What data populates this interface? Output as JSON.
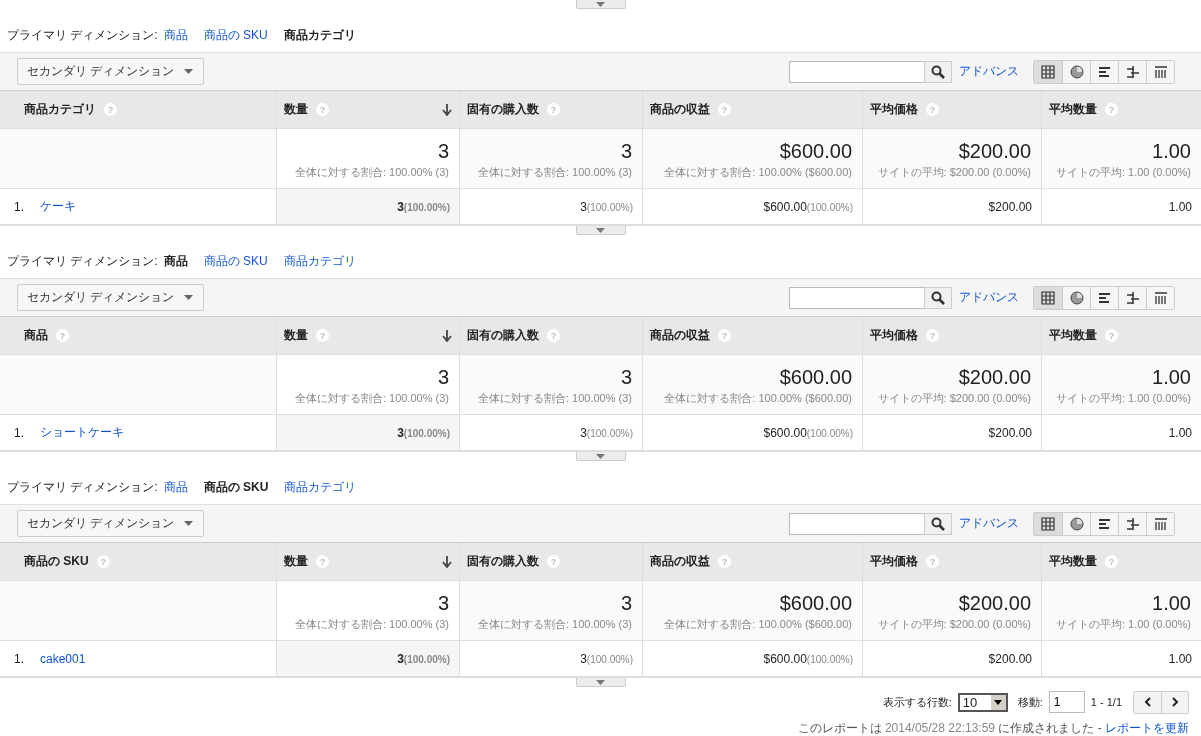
{
  "sections": [
    {
      "primary_dimension": {
        "label": "プライマリ ディメンション:",
        "options": [
          {
            "label": "商品",
            "selected": false
          },
          {
            "label": "商品の SKU",
            "selected": false
          },
          {
            "label": "商品カテゴリ",
            "selected": true
          }
        ]
      },
      "secondary_dimension": "セカンダリ ディメンション",
      "advanced_link": "アドバンス",
      "view_modes": [
        {
          "kind": "table",
          "selected": true
        },
        {
          "kind": "pie",
          "selected": false
        },
        {
          "kind": "bars",
          "selected": false
        },
        {
          "kind": "compare",
          "selected": false
        },
        {
          "kind": "pivot",
          "selected": false
        }
      ],
      "columns": [
        {
          "label": "商品カテゴリ",
          "help": "?",
          "sorted": false
        },
        {
          "label": "数量",
          "help": "?",
          "sorted": true
        },
        {
          "label": "固有の購入数",
          "help": "?",
          "sorted": false
        },
        {
          "label": "商品の収益",
          "help": "?",
          "sorted": false
        },
        {
          "label": "平均価格",
          "help": "?",
          "sorted": false
        },
        {
          "label": "平均数量",
          "help": "?",
          "sorted": false
        }
      ],
      "totals": [
        {
          "value": "3",
          "note": "全体に対する割合: 100.00% (3)"
        },
        {
          "value": "3",
          "note": "全体に対する割合: 100.00% (3)"
        },
        {
          "value": "$600.00",
          "note": "全体に対する割合: 100.00% ($600.00)"
        },
        {
          "value": "$200.00",
          "note": "サイトの平均: $200.00 (0.00%)"
        },
        {
          "value": "1.00",
          "note": "サイトの平均: 1.00 (0.00%)"
        }
      ],
      "rows": [
        {
          "index": "1.",
          "label": "ケーキ",
          "cells": [
            {
              "value": "3",
              "share": "(100.00%)"
            },
            {
              "value": "3",
              "share": "(100.00%)"
            },
            {
              "value": "$600.00",
              "share": "(100.00%)"
            },
            {
              "value": "$200.00"
            },
            {
              "value": "1.00"
            }
          ]
        }
      ]
    },
    {
      "primary_dimension": {
        "label": "プライマリ ディメンション:",
        "options": [
          {
            "label": "商品",
            "selected": true
          },
          {
            "label": "商品の SKU",
            "selected": false
          },
          {
            "label": "商品カテゴリ",
            "selected": false
          }
        ]
      },
      "secondary_dimension": "セカンダリ ディメンション",
      "advanced_link": "アドバンス",
      "view_modes": [
        {
          "kind": "table",
          "selected": true
        },
        {
          "kind": "pie",
          "selected": false
        },
        {
          "kind": "bars",
          "selected": false
        },
        {
          "kind": "compare",
          "selected": false
        },
        {
          "kind": "pivot",
          "selected": false
        }
      ],
      "columns": [
        {
          "label": "商品",
          "help": "?",
          "sorted": false
        },
        {
          "label": "数量",
          "help": "?",
          "sorted": true
        },
        {
          "label": "固有の購入数",
          "help": "?",
          "sorted": false
        },
        {
          "label": "商品の収益",
          "help": "?",
          "sorted": false
        },
        {
          "label": "平均価格",
          "help": "?",
          "sorted": false
        },
        {
          "label": "平均数量",
          "help": "?",
          "sorted": false
        }
      ],
      "totals": [
        {
          "value": "3",
          "note": "全体に対する割合: 100.00% (3)"
        },
        {
          "value": "3",
          "note": "全体に対する割合: 100.00% (3)"
        },
        {
          "value": "$600.00",
          "note": "全体に対する割合: 100.00% ($600.00)"
        },
        {
          "value": "$200.00",
          "note": "サイトの平均: $200.00 (0.00%)"
        },
        {
          "value": "1.00",
          "note": "サイトの平均: 1.00 (0.00%)"
        }
      ],
      "rows": [
        {
          "index": "1.",
          "label": "ショートケーキ",
          "cells": [
            {
              "value": "3",
              "share": "(100.00%)"
            },
            {
              "value": "3",
              "share": "(100.00%)"
            },
            {
              "value": "$600.00",
              "share": "(100.00%)"
            },
            {
              "value": "$200.00"
            },
            {
              "value": "1.00"
            }
          ]
        }
      ]
    },
    {
      "primary_dimension": {
        "label": "プライマリ ディメンション:",
        "options": [
          {
            "label": "商品",
            "selected": false
          },
          {
            "label": "商品の SKU",
            "selected": true
          },
          {
            "label": "商品カテゴリ",
            "selected": false
          }
        ]
      },
      "secondary_dimension": "セカンダリ ディメンション",
      "advanced_link": "アドバンス",
      "view_modes": [
        {
          "kind": "table",
          "selected": true
        },
        {
          "kind": "pie",
          "selected": false
        },
        {
          "kind": "bars",
          "selected": false
        },
        {
          "kind": "compare",
          "selected": false
        },
        {
          "kind": "pivot",
          "selected": false
        }
      ],
      "columns": [
        {
          "label": "商品の SKU",
          "help": "?",
          "sorted": false
        },
        {
          "label": "数量",
          "help": "?",
          "sorted": true
        },
        {
          "label": "固有の購入数",
          "help": "?",
          "sorted": false
        },
        {
          "label": "商品の収益",
          "help": "?",
          "sorted": false
        },
        {
          "label": "平均価格",
          "help": "?",
          "sorted": false
        },
        {
          "label": "平均数量",
          "help": "?",
          "sorted": false
        }
      ],
      "totals": [
        {
          "value": "3",
          "note": "全体に対する割合: 100.00% (3)"
        },
        {
          "value": "3",
          "note": "全体に対する割合: 100.00% (3)"
        },
        {
          "value": "$600.00",
          "note": "全体に対する割合: 100.00% ($600.00)"
        },
        {
          "value": "$200.00",
          "note": "サイトの平均: $200.00 (0.00%)"
        },
        {
          "value": "1.00",
          "note": "サイトの平均: 1.00 (0.00%)"
        }
      ],
      "rows": [
        {
          "index": "1.",
          "label": "cake001",
          "cells": [
            {
              "value": "3",
              "share": "(100.00%)"
            },
            {
              "value": "3",
              "share": "(100.00%)"
            },
            {
              "value": "$600.00",
              "share": "(100.00%)"
            },
            {
              "value": "$200.00"
            },
            {
              "value": "1.00"
            }
          ]
        }
      ]
    }
  ],
  "pagination": {
    "rows_label": "表示する行数:",
    "rows_value": "10",
    "goto_label": "移動:",
    "goto_value": "1",
    "range": "1 - 1/1"
  },
  "report_note": {
    "text_before": "このレポートは",
    "timestamp": "2014/05/28 22:13:59",
    "text_after": "に作成されました -",
    "refresh_link": "レポートを更新"
  }
}
